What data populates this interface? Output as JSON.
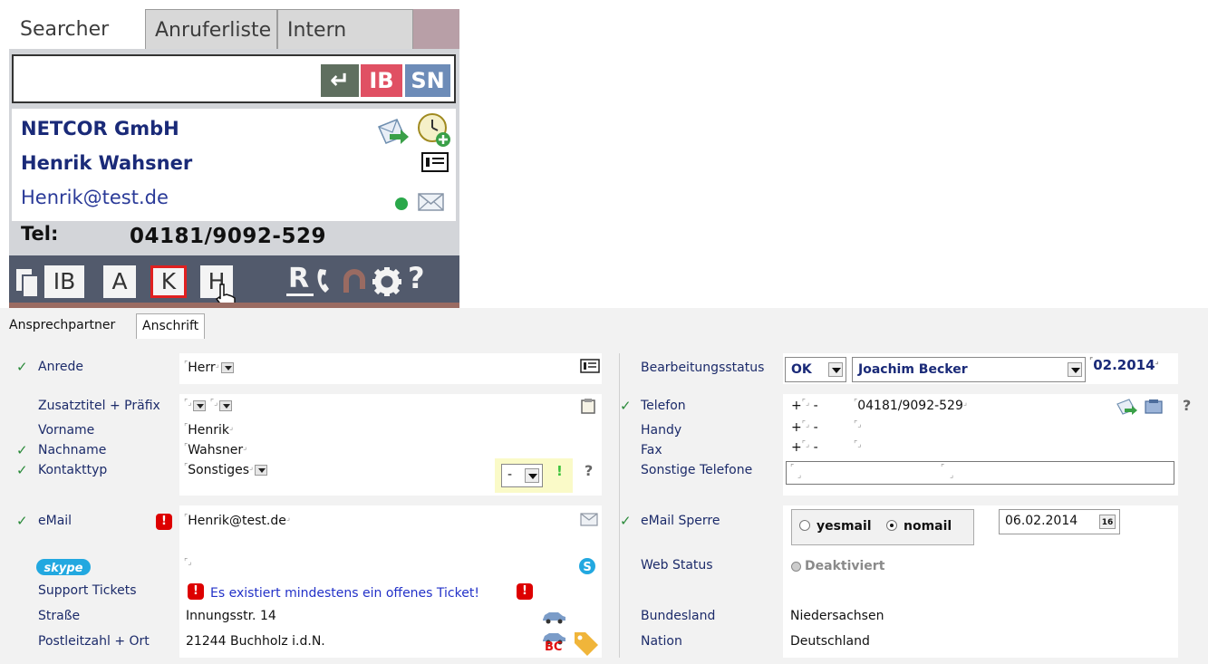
{
  "widget": {
    "tabs": [
      "Searcher",
      "Anruferliste",
      "Intern"
    ],
    "search": {
      "value": "",
      "buttons": {
        "enter": "↵",
        "ib": "IB",
        "sn": "SN"
      }
    },
    "contact": {
      "company": "NETCOR GmbH",
      "person": "Henrik Wahsner",
      "email": "Henrik@test.de",
      "tel_label": "Tel:",
      "tel_value": "04181/9092-529"
    },
    "bottom_buttons": {
      "ib": "IB",
      "a": "A",
      "k": "K",
      "h": "H",
      "r": "R",
      "help": "?"
    },
    "icons": [
      "send-mail-icon",
      "add-reminder-icon",
      "vcard-icon",
      "status-dot-icon",
      "envelope-icon",
      "clipboard-icon",
      "phone-icon",
      "refresh-icon",
      "gear-icon",
      "cursor-hand-icon"
    ]
  },
  "form": {
    "tabs": [
      "Ansprechpartner",
      "Anschrift"
    ],
    "left": {
      "anrede_label": "Anrede",
      "anrede_value": "Herr",
      "zusatz_label": "Zusatztitel + Präfix",
      "vorname_label": "Vorname",
      "vorname_value": "Henrik",
      "nachname_label": "Nachname",
      "nachname_value": "Wahsner",
      "kontakttyp_label": "Kontakttyp",
      "kontakttyp_value": "Sonstiges",
      "kontakttyp_select": "-",
      "email_label": "eMail",
      "email_value": "Henrik@test.de",
      "skype_label": "skype",
      "support_label": "Support Tickets",
      "support_value": "Es existiert mindestens ein offenes Ticket!",
      "strasse_label": "Straße",
      "strasse_value": "Innungsstr. 14",
      "plz_label": "Postleitzahl + Ort",
      "plz_value": "21244 Buchholz i.d.N."
    },
    "right": {
      "status_label": "Bearbeitungsstatus",
      "status_value": "OK",
      "bearbeiter_value": "Joachim Becker",
      "status_date": "02.2014",
      "telefon_label": "Telefon",
      "telefon_prefix": "+",
      "telefon_value": "04181/9092-529",
      "handy_label": "Handy",
      "fax_label": "Fax",
      "sonstige_label": "Sonstige Telefone",
      "sperre_label": "eMail Sperre",
      "yesmail": "yesmail",
      "nomail": "nomail",
      "sperre_date": "06.02.2014",
      "cal_badge": "16",
      "web_label": "Web Status",
      "web_value": "Deaktiviert",
      "bundesland_label": "Bundesland",
      "bundesland_value": "Niedersachsen",
      "nation_label": "Nation",
      "nation_value": "Deutschland"
    },
    "misc": {
      "dash": "-",
      "bang": "!",
      "help": "?",
      "bc": "BC"
    }
  },
  "colors": {
    "accent_blue": "#1a2a78",
    "ib_red": "#e05063",
    "sn_blue": "#6d8cb8",
    "check_green": "#2a8a3a",
    "alert_red": "#d00000"
  }
}
